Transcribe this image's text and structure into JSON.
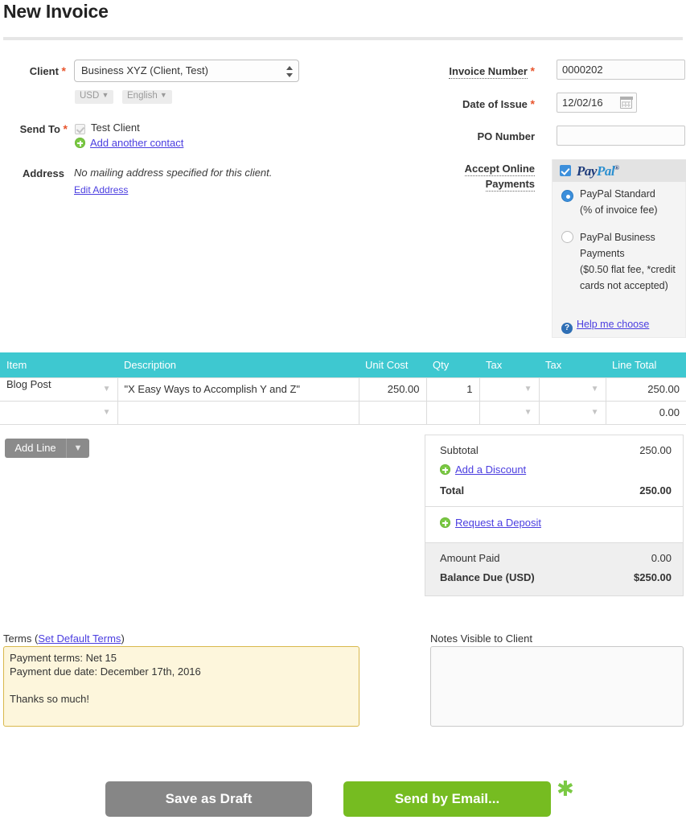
{
  "page": {
    "title": "New Invoice"
  },
  "form": {
    "client": {
      "label": "Client",
      "required_mark": "*",
      "value": "Business XYZ (Client, Test)",
      "currency_pill": "USD",
      "language_pill": "English",
      "caret": "▼"
    },
    "send_to": {
      "label": "Send To",
      "required_mark": "*",
      "contact": "Test Client",
      "add_contact_link": "Add another contact"
    },
    "address": {
      "label": "Address",
      "value": "No mailing address specified for this client.",
      "edit_link": "Edit Address"
    },
    "invoice_number": {
      "label": "Invoice Number",
      "required_mark": "*",
      "value": "0000202"
    },
    "date_of_issue": {
      "label": "Date of Issue",
      "required_mark": "*",
      "value": "12/02/16"
    },
    "po_number": {
      "label": "PO Number",
      "value": "",
      "placeholder": ""
    }
  },
  "online_payments": {
    "label": "Accept Online Payments",
    "provider": {
      "name_part1": "Pay",
      "name_part2": "Pal",
      "tm": "®",
      "enabled": true
    },
    "options": [
      {
        "title": "PayPal Standard",
        "subtitle": "(% of invoice fee)",
        "selected": true
      },
      {
        "title": "PayPal Business Payments",
        "subtitle": "($0.50 flat fee, *credit cards not accepted)",
        "selected": false
      }
    ],
    "help_link": "Help me choose",
    "help_icon_glyph": "?"
  },
  "items": {
    "columns": [
      "Item",
      "Description",
      "Unit Cost",
      "Qty",
      "Tax",
      "Tax",
      "Line Total"
    ],
    "rows": [
      {
        "item": "Blog Post",
        "description": "\"X Easy Ways to Accomplish Y and Z\"",
        "unit_cost": "250.00",
        "qty": "1",
        "tax1": "",
        "tax2": "",
        "line_total": "250.00"
      },
      {
        "item": "",
        "description": "",
        "unit_cost": "",
        "qty": "",
        "tax1": "",
        "tax2": "",
        "line_total": "0.00"
      }
    ],
    "add_line_label": "Add Line",
    "add_line_caret": "▼"
  },
  "totals": {
    "subtotal_label": "Subtotal",
    "subtotal_value": "250.00",
    "discount_link": "Add a Discount",
    "total_label": "Total",
    "total_value": "250.00",
    "deposit_link": "Request a Deposit",
    "amount_paid_label": "Amount Paid",
    "amount_paid_value": "0.00",
    "balance_due_label": "Balance Due (USD)",
    "balance_due_value": "$250.00"
  },
  "terms": {
    "label": "Terms (",
    "label_link": "Set Default Terms",
    "label_close": ")",
    "value": "Payment terms: Net 15\nPayment due date: December 17th, 2016\n\nThanks so much!"
  },
  "notes": {
    "label": "Notes Visible to Client",
    "value": ""
  },
  "footer": {
    "save_draft_label": "Save as Draft",
    "send_email_label": "Send by Email...",
    "required_star": "✱"
  },
  "colors": {
    "table_header": "#3ec8d0",
    "send_button": "#76bc21",
    "draft_button": "#868686",
    "required_asterisk": "#e8552d",
    "link": "#4b3ee0",
    "plus_icon": "#7ac943",
    "terms_bg": "#fdf6dc",
    "terms_border": "#d9b84c"
  }
}
